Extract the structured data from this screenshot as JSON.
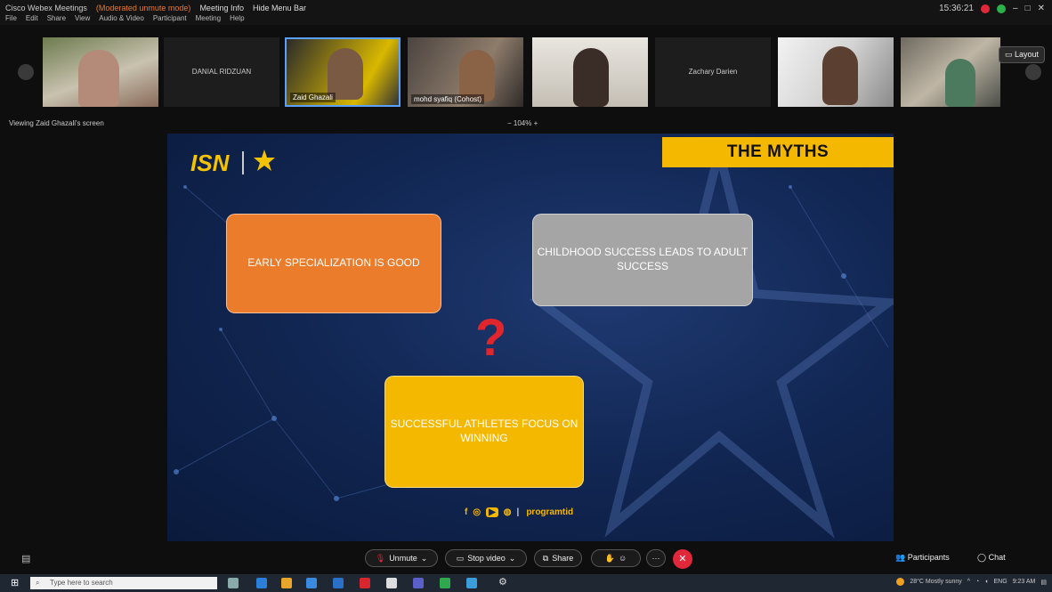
{
  "titlebar": {
    "app_title": "Cisco Webex Meetings",
    "mode": "(Moderated unmute mode)",
    "meeting_info": "Meeting Info",
    "hide_menu": "Hide Menu Bar",
    "time": "15:36:21",
    "menu": [
      "File",
      "Edit",
      "Share",
      "View",
      "Audio & Video",
      "Participant",
      "Meeting",
      "Help"
    ]
  },
  "filmstrip": {
    "participants": [
      {
        "name": ""
      },
      {
        "name": "DANIAL RIDZUAN"
      },
      {
        "name": "Zaid Ghazali"
      },
      {
        "name": "mohd syafiq (Cohost)"
      },
      {
        "name": ""
      },
      {
        "name": "Zachary Darien"
      },
      {
        "name": ""
      },
      {
        "name": ""
      }
    ],
    "layout_label": "Layout"
  },
  "viewing": {
    "label": "Viewing Zaid Ghazali's screen",
    "zoom": "104%"
  },
  "slide": {
    "logo": "ISN",
    "title": "THE MYTHS",
    "card1": "EARLY SPECIALIZATION IS GOOD",
    "card2": "CHILDHOOD SUCCESS LEADS TO ADULT SUCCESS",
    "card3": "SUCCESSFUL ATHLETES FOCUS ON WINNING",
    "question": "?",
    "handle": "programtid",
    "colors": {
      "orange": "#ea7c2c",
      "grey": "#a5a5a5",
      "yellow": "#f5b800",
      "accent": "#e0262c"
    }
  },
  "controls": {
    "unmute": "Unmute",
    "stop_video": "Stop video",
    "share": "Share",
    "participants": "Participants",
    "chat": "Chat"
  },
  "taskbar": {
    "search_placeholder": "Type here to search",
    "weather": "28°C  Mostly sunny",
    "lang": "ENG",
    "clock": "9:23 AM"
  }
}
